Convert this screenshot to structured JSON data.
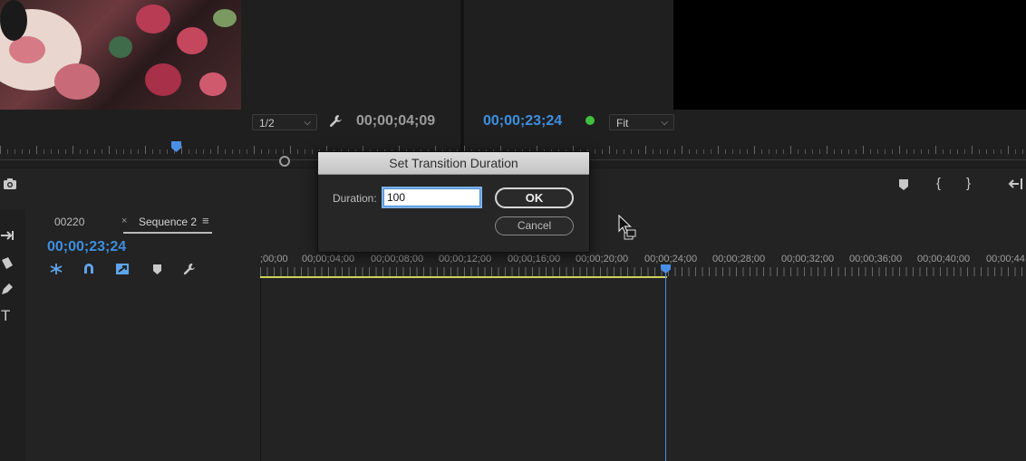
{
  "source_monitor": {
    "resolution": "1/2",
    "timecode": "00;00;04;09"
  },
  "program_monitor": {
    "timecode": "00;00;23;24",
    "zoom": "Fit"
  },
  "timeline": {
    "tabs": [
      {
        "label": "00220"
      },
      {
        "label": "Sequence 2"
      }
    ],
    "timecode": "00;00;23;24",
    "ruler_labels": [
      ";00;00",
      "00;00;04;00",
      "00;00;08;00",
      "00;00;12;00",
      "00;00;16;00",
      "00;00;20;00",
      "00;00;24;00",
      "00;00;28;00",
      "00;00;32;00",
      "00;00;36;00",
      "00;00;40;00",
      "00;00;44"
    ]
  },
  "dialog": {
    "title": "Set Transition Duration",
    "duration_label": "Duration:",
    "duration_value": "100",
    "ok_label": "OK",
    "cancel_label": "Cancel"
  },
  "colors": {
    "timecode_blue": "#3d8fe0",
    "playhead": "#4a8fe6",
    "work_area": "#cfd35a",
    "status_dot": "#3fbf3f"
  }
}
